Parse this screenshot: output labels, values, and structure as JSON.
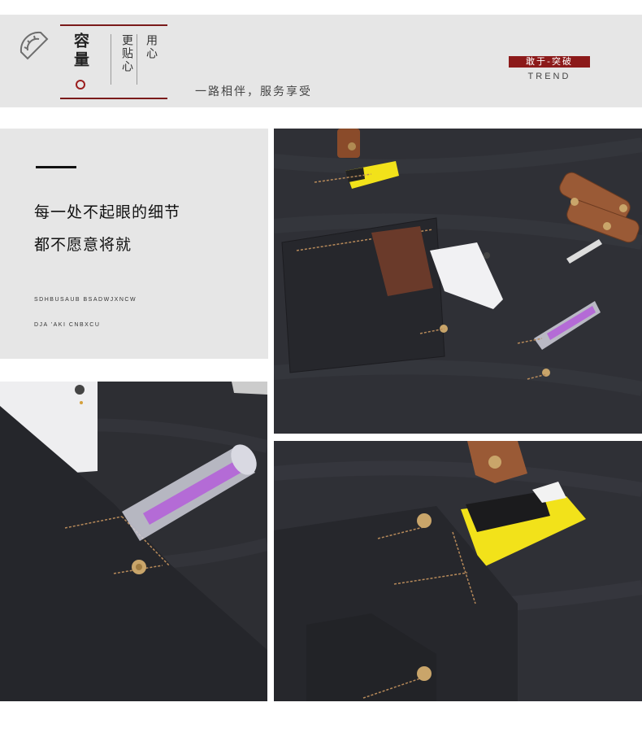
{
  "header": {
    "icon": "protractor-icon",
    "title_chars": "容量",
    "sub_col_1": "更贴心",
    "sub_col_2": "用心",
    "slogan": "一路相伴，服务享受",
    "badge": "敢于-突破",
    "trend": "TREND"
  },
  "text_panel": {
    "line_1": "每一处不起眼的细节",
    "line_2": "都不愿意将就",
    "tiny_1": "SDHBUSAUB BSADWJXNCW",
    "tiny_2": "DJA 'AKI CNBXCU"
  },
  "colors": {
    "accent": "#8c1a1a",
    "panel": "#e6e6e6",
    "canvas": "#2c2c31",
    "leather": "#8a4b2a",
    "knife": "#f2e21a",
    "handle": "#b46bd6"
  }
}
